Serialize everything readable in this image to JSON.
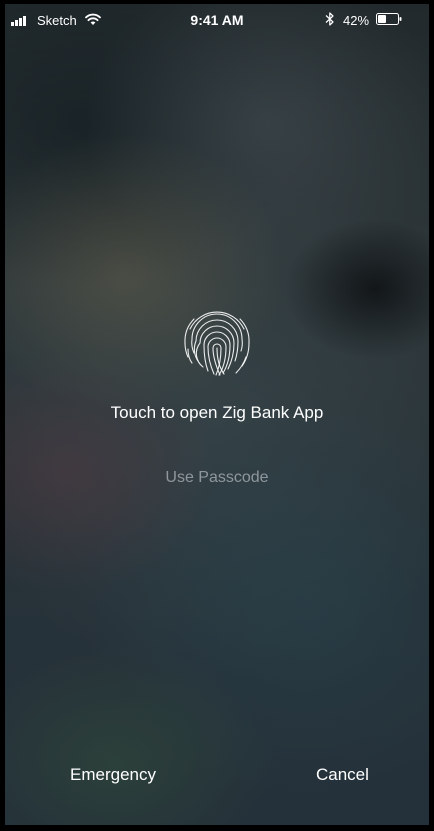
{
  "status_bar": {
    "carrier": "Sketch",
    "time": "9:41 AM",
    "battery_percent": "42%",
    "battery_level": 0.42,
    "icons": [
      "signal-bars-icon",
      "wifi-icon",
      "bluetooth-icon",
      "battery-icon"
    ]
  },
  "touch_id": {
    "icon": "fingerprint-icon",
    "prompt": "Touch to open Zig Bank App",
    "passcode_label": "Use Passcode"
  },
  "bottom": {
    "emergency_label": "Emergency",
    "cancel_label": "Cancel"
  },
  "colors": {
    "text": "#ffffff",
    "secondary_text": "#c8cdd2"
  }
}
